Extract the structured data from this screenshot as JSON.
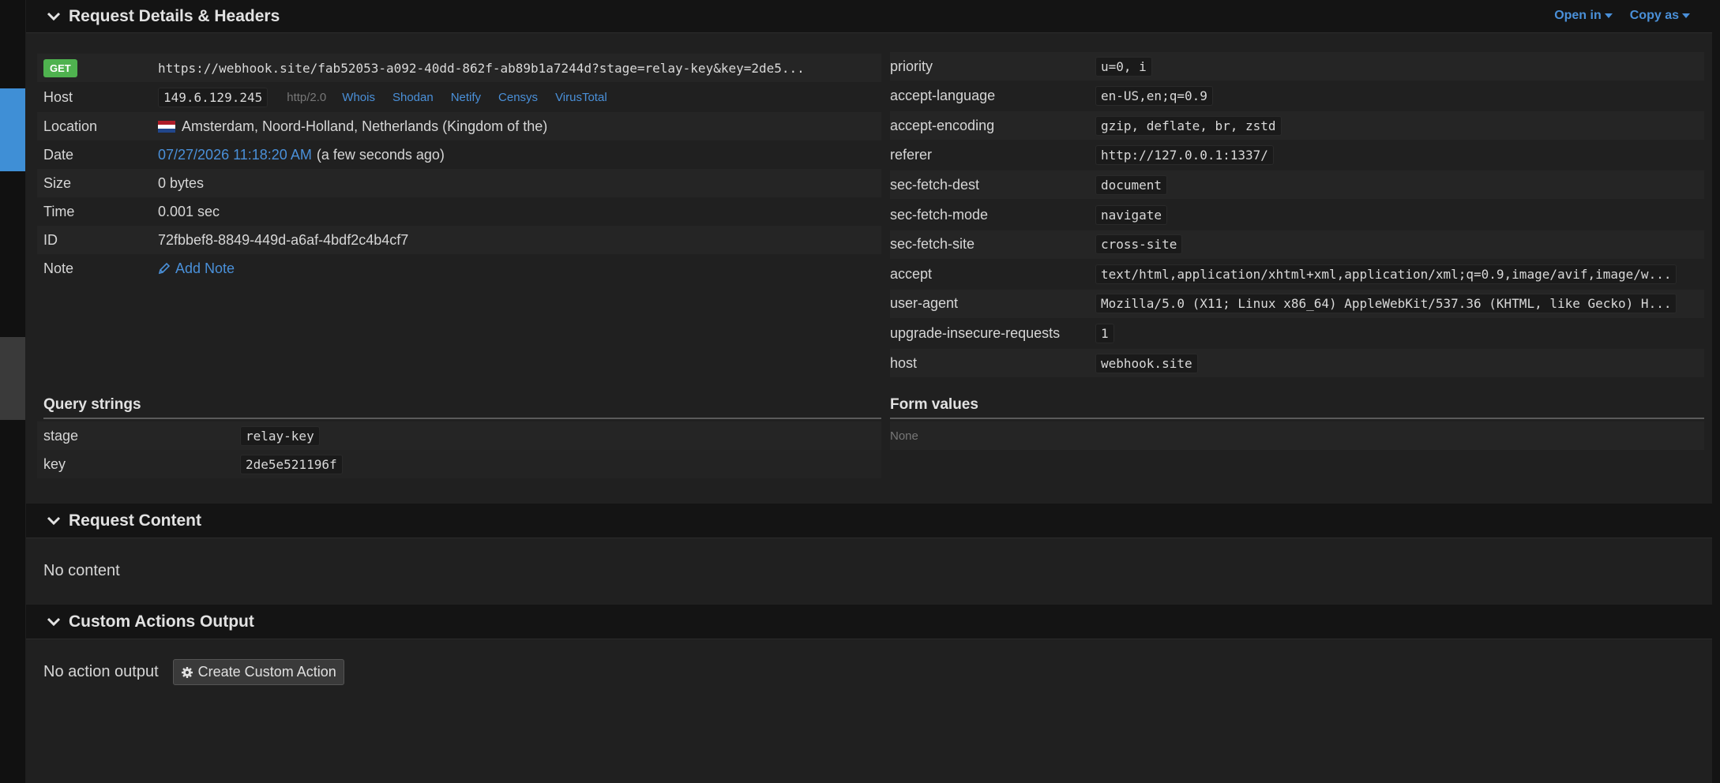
{
  "header": {
    "title": "Request Details & Headers",
    "open_in": "Open in",
    "copy_as": "Copy as"
  },
  "request": {
    "method": "GET",
    "url": "https://webhook.site/fab52053-a092-40dd-862f-ab89b1a7244d?stage=relay-key&key=2de5...",
    "host_label": "Host",
    "ip": "149.6.129.245",
    "protocol": "http/2.0",
    "host_links": [
      "Whois",
      "Shodan",
      "Netify",
      "Censys",
      "VirusTotal"
    ],
    "location_label": "Location",
    "location": "Amsterdam, Noord-Holland, Netherlands (Kingdom of the)",
    "date_label": "Date",
    "date": "07/27/2026 11:18:20 AM",
    "date_relative": "(a few seconds ago)",
    "size_label": "Size",
    "size": "0 bytes",
    "time_label": "Time",
    "time": "0.001 sec",
    "id_label": "ID",
    "id": "72fbbef8-8849-449d-a6af-4bdf2c4b4cf7",
    "note_label": "Note",
    "add_note": "Add Note"
  },
  "headers": [
    {
      "name": "priority",
      "value": "u=0, i"
    },
    {
      "name": "accept-language",
      "value": "en-US,en;q=0.9"
    },
    {
      "name": "accept-encoding",
      "value": "gzip, deflate, br, zstd"
    },
    {
      "name": "referer",
      "value": "http://127.0.0.1:1337/"
    },
    {
      "name": "sec-fetch-dest",
      "value": "document"
    },
    {
      "name": "sec-fetch-mode",
      "value": "navigate"
    },
    {
      "name": "sec-fetch-site",
      "value": "cross-site"
    },
    {
      "name": "accept",
      "value": "text/html,application/xhtml+xml,application/xml;q=0.9,image/avif,image/w..."
    },
    {
      "name": "user-agent",
      "value": "Mozilla/5.0 (X11; Linux x86_64) AppleWebKit/537.36 (KHTML, like Gecko) H..."
    },
    {
      "name": "upgrade-insecure-requests",
      "value": "1"
    },
    {
      "name": "host",
      "value": "webhook.site"
    }
  ],
  "query_strings": {
    "title": "Query strings",
    "items": [
      {
        "name": "stage",
        "value": "relay-key"
      },
      {
        "name": "key",
        "value": "2de5e521196f"
      }
    ]
  },
  "form_values": {
    "title": "Form values",
    "empty": "None"
  },
  "request_content": {
    "title": "Request Content",
    "body": "No content"
  },
  "custom_actions": {
    "title": "Custom Actions Output",
    "body": "No action output",
    "button": "Create Custom Action"
  }
}
